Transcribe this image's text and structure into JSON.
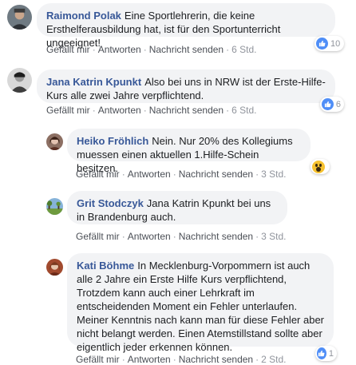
{
  "comments": [
    {
      "author": "Raimond Polak",
      "text": "Eine Sportlehrerin, die keine Ersthelferausbildung hat, ist für den Sportunterricht ungeeignet!",
      "reaction_count": "10",
      "reaction_type": "like-icon",
      "actions": {
        "like": "Gefällt mir",
        "reply": "Antworten",
        "message": "Nachricht senden",
        "time": "6 Std."
      }
    },
    {
      "author": "Jana Katrin Kpunkt",
      "text": "Also bei uns in NRW ist der Erste-Hilfe-Kurs alle zwei Jahre verpflichtend.",
      "reaction_count": "6",
      "reaction_type": "like-icon",
      "actions": {
        "like": "Gefällt mir",
        "reply": "Antworten",
        "message": "Nachricht senden",
        "time": "6 Std."
      }
    },
    {
      "author": "Heiko Fröhlich",
      "text": "Nein. Nur 20% des Kollegiums muessen einen aktuellen 1.Hilfe-Schein besitzen.",
      "reaction_count": "",
      "reaction_type": "wow-icon",
      "actions": {
        "like": "Gefällt mir",
        "reply": "Antworten",
        "message": "Nachricht senden",
        "time": "3 Std."
      }
    },
    {
      "author": "Grit Stodczyk",
      "text": "Jana Katrin Kpunkt bei uns in Brandenburg auch.",
      "reaction_count": "",
      "reaction_type": "",
      "actions": {
        "like": "Gefällt mir",
        "reply": "Antworten",
        "message": "Nachricht senden",
        "time": "3 Std."
      }
    },
    {
      "author": "Kati Böhme",
      "text": "In Mecklenburg-Vorpommern ist auch alle 2 Jahre ein Erste Hilfe Kurs verpflichtend, Trotzdem kann auch einer Lehrkraft im entscheidenden Moment ein Fehler unterlaufen. Meiner Kenntnis nach kann man für diese Fehler aber nicht belangt werden. Einen Atemstillstand sollte aber eigentlich jeder erkennen können.",
      "reaction_count": "1",
      "reaction_type": "like-icon",
      "actions": {
        "like": "Gefällt mir",
        "reply": "Antworten",
        "message": "Nachricht senden",
        "time": "2 Std."
      }
    }
  ],
  "separator": "·",
  "colors": {
    "author": "#385898",
    "bubble": "#f2f3f5",
    "like": "#4f8ef7",
    "meta": "#90949c"
  }
}
